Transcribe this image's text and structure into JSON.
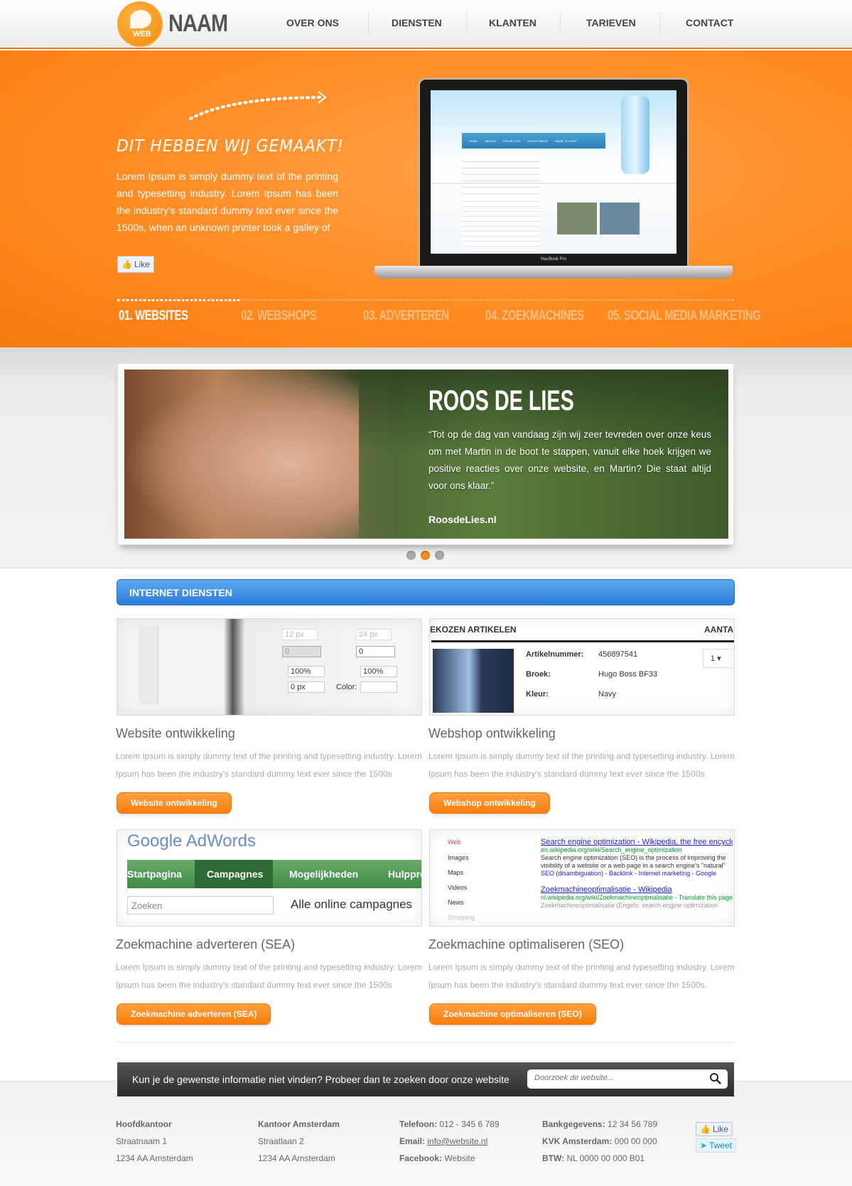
{
  "brand": {
    "logo_badge": "WEB",
    "name": "NAAM",
    "accent": "#f7931e"
  },
  "nav": [
    "OVER ONS",
    "DIENSTEN",
    "KLANTEN",
    "TARIEVEN",
    "CONTACT"
  ],
  "hero": {
    "title": "DIT HEBBEN WIJ GEMAAKT!",
    "text": "Lorem Ipsum is simply dummy text of the printing and typesetting industry. Lorem Ipsum has been the industry's standard dummy text ever since the 1500s, when an unknown printer took a galley of",
    "like": "Like",
    "laptop_label": "MacBook Pro",
    "screen_nav": [
      "HOME",
      "NIEUWS",
      "PROJECTEN",
      "ASSORTIMENT",
      "WAAR TE KOOP"
    ],
    "tabs": [
      "01. WEBSITES",
      "02. WEBSHOPS",
      "03. ADVERTEREN",
      "04. ZOEKMACHINES",
      "05. SOCIAL MEDIA MARKETING"
    ],
    "active_tab": 0
  },
  "slider": {
    "name": "ROOS DE LIES",
    "quote": "“Tot op de dag van vandaag zijn wij zeer tevreden over onze keus om met Martin in de boot te stappen, vanuit elke hoek krijgen we positive reacties over onze website, en Martin? Die staat altijd voor ons klaar.”",
    "site": "RoosdeLies.nl",
    "slides": 3,
    "active_slide": 1
  },
  "services": {
    "heading": "INTERNET DIENSTEN",
    "items": [
      {
        "title": "Website ontwikkeling",
        "text": "Lorem Ipsum is simply dummy text of the printing and typesetting industry. Lorem Ipsum has been the industry's standard dummy text ever since the 1500s",
        "button": "Website ontwikkeling",
        "thumb": {
          "fields": [
            "12 px",
            "24 px",
            "0",
            "0",
            "100%",
            "100%",
            "0 px"
          ],
          "color_label": "Color:"
        }
      },
      {
        "title": "Webshop ontwikkeling",
        "text": "Lorem Ipsum is simply dummy text of the printing and typesetting industry. Lorem Ipsum has been the industry's standard dummy text ever since the 1500s.",
        "button": "Webshop ontwikkeling",
        "thumb": {
          "header": "EKOZEN ARTIKELEN",
          "header_right": "AANTAL",
          "rows": [
            [
              "Artikelnummer:",
              "456897541"
            ],
            [
              "Broek:",
              "Hugo Boss BF33"
            ],
            [
              "Kleur:",
              "Navy"
            ]
          ],
          "qty": "1"
        }
      },
      {
        "title": "Zoekmachine adverteren (SEA)",
        "text": "Lorem Ipsum is simply dummy text of the printing and typesetting industry. Lorem Ipsum has been the industry's standard dummy text ever since the 1500s",
        "button": "Zoekmachine adverteren (SEA)",
        "thumb": {
          "logo": "Google AdWords",
          "tabs": [
            "Startpagina",
            "Campagnes",
            "Mogelijkheden",
            "Hulpprogramma's"
          ],
          "search_placeholder": "Zoeken",
          "heading": "Alle online campagnes"
        }
      },
      {
        "title": "Zoekmachine optimaliseren (SEO)",
        "text": "Lorem Ipsum is simply dummy text of the printing and typesetting industry. Lorem Ipsum has been the industry's standard dummy text ever since the 1500s.",
        "button": "Zoekmachine optimaliseren (SEO)",
        "thumb": {
          "menu": [
            "Web",
            "Images",
            "Maps",
            "Videos",
            "News",
            "Shopping"
          ],
          "r1_title": "Search engine optimization - Wikipedia, the free encyclopedia",
          "r1_url": "en.wikipedia.org/wiki/Search_engine_optimization",
          "r1_text": "Search engine optimization (SEO) is the process of improving the visibility of a website or a web page in a search engine's \"natural\" or un-paid (\"organic\")",
          "r1_links": "SEO (disambiguation) - Backlink - Internet marketing - Google",
          "r2_title": "Zoekmachineoptimalisatie - Wikipedia",
          "r2_url": "nl.wikipedia.org/wiki/Zoekmachineoptimalisatie - Translate this page",
          "r2_text": "Zoekmachineoptimalisatie (Engels: search engine optimization"
        }
      }
    ]
  },
  "search": {
    "prompt": "Kun je de gewenste informatie niet vinden? Probeer dan te zoeken door onze website",
    "placeholder": "Doorzoek de website..."
  },
  "footer": {
    "col1": [
      "Hoofdkantoor",
      "Straatnaam 1",
      "1234 AA Amsterdam"
    ],
    "col2": [
      "Kantoor Amsterdam",
      "Straatlaan 2",
      "1234 AA Amsterdam"
    ],
    "col3": [
      {
        "label": "Telefoon:",
        "value": "012 - 345 6 789"
      },
      {
        "label": "Email:",
        "value": "info@website.nl"
      },
      {
        "label": "Facebook:",
        "value": "Website"
      }
    ],
    "col4": [
      {
        "label": "Bankgegevens:",
        "value": "12 34 56 789"
      },
      {
        "label": "KVK Amsterdam:",
        "value": "000 00 000"
      },
      {
        "label": "BTW:",
        "value": "NL 0000 00 000 B01"
      }
    ],
    "like": "Like",
    "tweet": "Tweet"
  }
}
